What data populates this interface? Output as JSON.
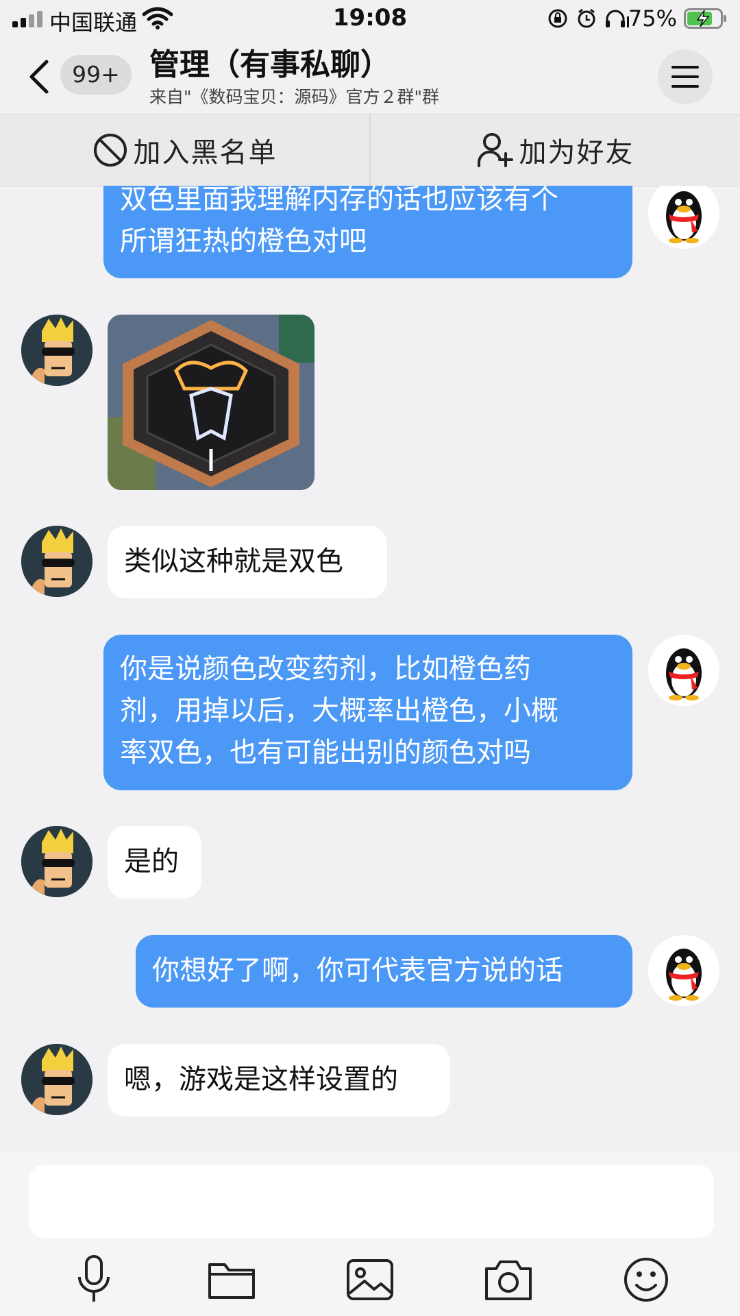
{
  "status_bar": {
    "carrier": "中国联通",
    "time": "19:08",
    "battery_percent": "75%",
    "icons": [
      "signal-icon",
      "wifi-icon",
      "rotation-lock-icon",
      "alarm-icon",
      "headphones-icon",
      "battery-charging-icon"
    ]
  },
  "header": {
    "unread_badge": "99+",
    "title": "管理（有事私聊）",
    "subtitle": "来自\"《数码宝贝：源码》官方２群\"群"
  },
  "actions": {
    "block_label": "加入黑名单",
    "add_friend_label": "加为好友"
  },
  "messages": [
    {
      "side": "out",
      "type": "text",
      "lines": [
        "双色里面我理解内存的话也应该有个",
        "所谓狂热的橙色对吧"
      ]
    },
    {
      "side": "in",
      "type": "image",
      "description_icon": "hexagon-emblem-image"
    },
    {
      "side": "in",
      "type": "text",
      "lines": [
        "类似这种就是双色"
      ]
    },
    {
      "side": "out",
      "type": "text",
      "lines": [
        "你是说颜色改变药剂，比如橙色药",
        "剂，用掉以后，大概率出橙色，小概",
        "率双色，也有可能出别的颜色对吗"
      ]
    },
    {
      "side": "in",
      "type": "text",
      "lines": [
        "是的"
      ]
    },
    {
      "side": "out",
      "type": "text",
      "lines": [
        "你想好了啊，你可代表官方说的话"
      ]
    },
    {
      "side": "in",
      "type": "text",
      "lines": [
        "嗯，游戏是这样设置的"
      ]
    }
  ],
  "composer": {
    "input_value": "",
    "tools": [
      "microphone-icon",
      "folder-icon",
      "image-icon",
      "camera-icon",
      "emoji-icon"
    ]
  },
  "colors": {
    "outgoing_bubble": "#4b98f7",
    "incoming_bubble": "#ffffff",
    "background": "#f1f1f3"
  }
}
